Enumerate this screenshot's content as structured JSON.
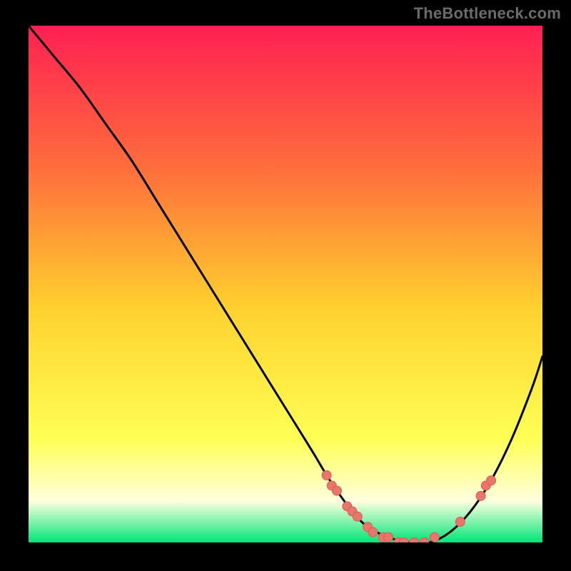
{
  "watermark": "TheBottleneck.com",
  "colors": {
    "background": "#000000",
    "gradient_top": "#ff1f52",
    "gradient_mid_upper": "#ff6f3b",
    "gradient_mid": "#ffd22e",
    "gradient_lower": "#ffff55",
    "gradient_pale": "#ffffe0",
    "gradient_bottom": "#00e676",
    "curve": "#000000",
    "marker_fill": "#e9766b",
    "marker_stroke": "#d85a50"
  },
  "chart_data": {
    "type": "line",
    "title": "",
    "xlabel": "",
    "ylabel": "",
    "xlim": [
      0,
      100
    ],
    "ylim": [
      0,
      100
    ],
    "grid": false,
    "legend": false,
    "series": [
      {
        "name": "bottleneck-curve",
        "x": [
          0,
          5,
          10,
          15,
          20,
          25,
          30,
          35,
          40,
          45,
          50,
          55,
          58,
          60,
          63,
          66,
          70,
          74,
          78,
          82,
          86,
          90,
          94,
          98,
          100
        ],
        "y": [
          100,
          94,
          88,
          81,
          74,
          66,
          58,
          50,
          42,
          34,
          26,
          18,
          13,
          10,
          6,
          3,
          1,
          0,
          0,
          2,
          6,
          12,
          20,
          30,
          36
        ]
      }
    ],
    "markers": [
      {
        "x": 58,
        "y": 13
      },
      {
        "x": 59,
        "y": 11
      },
      {
        "x": 60,
        "y": 10
      },
      {
        "x": 62,
        "y": 7
      },
      {
        "x": 63,
        "y": 6
      },
      {
        "x": 64,
        "y": 5
      },
      {
        "x": 66,
        "y": 3
      },
      {
        "x": 67,
        "y": 2
      },
      {
        "x": 69,
        "y": 1
      },
      {
        "x": 70,
        "y": 1
      },
      {
        "x": 72,
        "y": 0
      },
      {
        "x": 73,
        "y": 0
      },
      {
        "x": 75,
        "y": 0
      },
      {
        "x": 77,
        "y": 0
      },
      {
        "x": 79,
        "y": 1
      },
      {
        "x": 84,
        "y": 4
      },
      {
        "x": 88,
        "y": 9
      },
      {
        "x": 89,
        "y": 11
      },
      {
        "x": 90,
        "y": 12
      }
    ]
  }
}
